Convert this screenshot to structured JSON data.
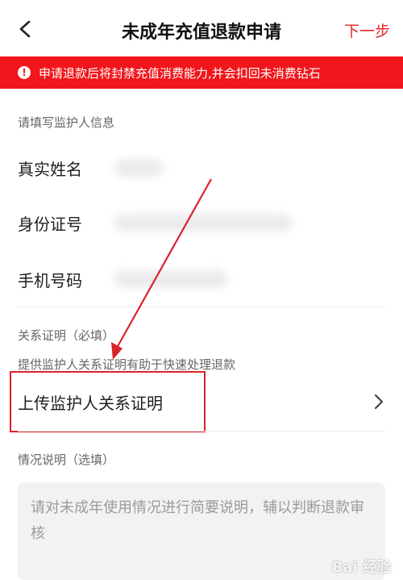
{
  "header": {
    "title": "未成年充值退款申请",
    "next_label": "下一步",
    "back_icon": "chevron-left-icon"
  },
  "warning": {
    "text": "申请退款后将封禁充值消费能力,并会扣回未消费钻石",
    "icon_glyph": "!",
    "color": "#f0161b"
  },
  "guardian_section": {
    "label": "请填写监护人信息",
    "fields": [
      {
        "label": "真实姓名"
      },
      {
        "label": "身份证号"
      },
      {
        "label": "手机号码"
      }
    ]
  },
  "relation_section": {
    "label": "关系证明（必填）",
    "hint": "提供监护人关系证明有助于快速处理退款",
    "upload_label": "上传监护人关系证明",
    "upload_icon": "chevron-right-icon"
  },
  "situation_section": {
    "label": "情况说明（选填）",
    "placeholder": "请对未成年使用情况进行简要说明，辅以判断退款审核"
  },
  "watermark": "Bai 经验",
  "colors": {
    "accent": "#e8252a",
    "annotation": "#d9232b"
  }
}
